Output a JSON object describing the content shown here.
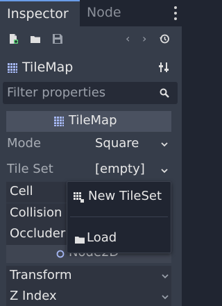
{
  "tabs": [
    {
      "label": "Inspector",
      "active": true
    },
    {
      "label": "Node",
      "active": false
    }
  ],
  "toolbar": {
    "icons": [
      "new-resource-icon",
      "open-folder-icon",
      "save-icon",
      "history-back-icon",
      "history-forward-icon",
      "history-icon"
    ],
    "nav_back": "‹",
    "nav_forward": "›"
  },
  "object": {
    "name": "TileMap"
  },
  "filter": {
    "placeholder": "Filter properties"
  },
  "section": {
    "title": "TileMap"
  },
  "properties": {
    "mode": {
      "label": "Mode",
      "value": "Square"
    },
    "tile_set": {
      "label": "Tile Set",
      "value": "[empty]"
    }
  },
  "groups": {
    "cell": "Cell",
    "collision": "Collision",
    "occluder": "Occluder",
    "transform": "Transform",
    "z_index": "Z Index"
  },
  "node2d": {
    "title": "Node2D"
  },
  "popup": {
    "new_tileset": "New TileSet",
    "load": "Load"
  },
  "colors": {
    "background": "#202531",
    "panel": "#363d4a",
    "accent": "#699ce8",
    "section_header": "#4a5160"
  }
}
